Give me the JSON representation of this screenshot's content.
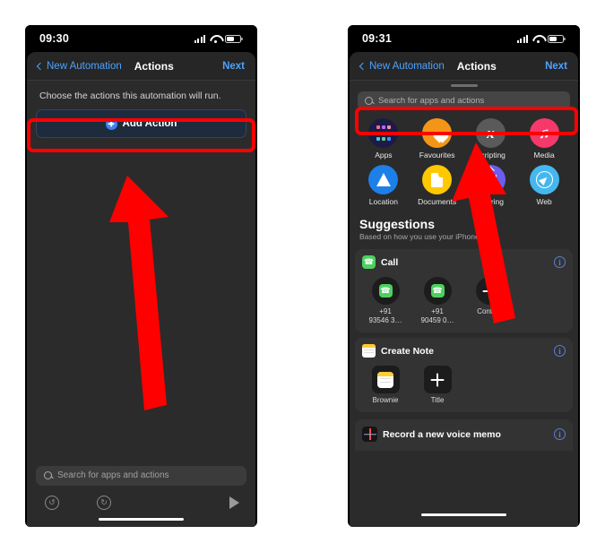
{
  "page": {
    "background": "#ffffff",
    "annotation_color": "#ff0000"
  },
  "left_phone": {
    "status": {
      "time": "09:30",
      "signal_icon": "cellular-bars-icon",
      "wifi_icon": "wifi-icon",
      "battery_icon": "battery-icon"
    },
    "nav": {
      "back_label": "New Automation",
      "title": "Actions",
      "next_label": "Next"
    },
    "hint": "Choose the actions this automation will run.",
    "add_action": {
      "label": "Add Action",
      "icon": "plus-circle-icon",
      "accent": "#3b82f6"
    },
    "search": {
      "placeholder": "Search for apps and actions",
      "icon": "search-icon"
    },
    "toolbar": {
      "undo": "undo-icon",
      "redo": "redo-icon",
      "play": "play-icon"
    }
  },
  "right_phone": {
    "status": {
      "time": "09:31",
      "signal_icon": "cellular-bars-icon",
      "wifi_icon": "wifi-icon",
      "battery_icon": "battery-icon"
    },
    "nav": {
      "back_label": "New Automation",
      "title": "Actions",
      "next_label": "Next"
    },
    "search": {
      "placeholder": "Search for apps and actions",
      "icon": "search-icon"
    },
    "categories": [
      {
        "label": "Apps",
        "icon": "apps-grid-icon",
        "color": "#1b1b46"
      },
      {
        "label": "Favourites",
        "icon": "heart-icon",
        "color": "#f59518"
      },
      {
        "label": "Scripting",
        "icon": "script-x-icon",
        "color": "#5a5a5a"
      },
      {
        "label": "Media",
        "icon": "music-note-icon",
        "color": "#f7386a"
      },
      {
        "label": "Location",
        "icon": "location-arrow-icon",
        "color": "#1d7fe8"
      },
      {
        "label": "Documents",
        "icon": "document-icon",
        "color": "#ffc800"
      },
      {
        "label": "Sharing",
        "icon": "share-icon",
        "color": "#6a5df0"
      },
      {
        "label": "Web",
        "icon": "safari-compass-icon",
        "color": "#45b7ef"
      }
    ],
    "suggestions": {
      "title": "Suggestions",
      "subtitle": "Based on how you use your iPhone.",
      "groups": [
        {
          "name": "Call",
          "icon": "phone-icon",
          "icon_color": "#4cd15f",
          "info_icon": "info-circle-icon",
          "items": [
            {
              "label": "+91\n93546 3…",
              "icon": "phone-icon"
            },
            {
              "label": "+91\n90459 0…",
              "icon": "phone-icon"
            },
            {
              "label": "Contact",
              "icon": "plus-icon"
            }
          ]
        },
        {
          "name": "Create Note",
          "icon": "notes-icon",
          "icon_color": "#ffcc33",
          "info_icon": "info-circle-icon",
          "items": [
            {
              "label": "Brownie",
              "icon": "notes-icon"
            },
            {
              "label": "Title",
              "icon": "plus-icon"
            }
          ]
        }
      ],
      "memo": {
        "name": "Record a new voice memo",
        "icon": "voice-memo-icon",
        "info_icon": "info-circle-icon"
      }
    }
  },
  "annotations": {
    "left_arrow": {
      "name": "up-arrow-pointing-to-add-action",
      "color": "#ff0000"
    },
    "right_arrow": {
      "name": "up-arrow-pointing-to-search",
      "color": "#ff0000"
    },
    "left_box": {
      "name": "highlight-add-action",
      "color": "#ff0000"
    },
    "right_box": {
      "name": "highlight-search-field",
      "color": "#ff0000"
    }
  }
}
